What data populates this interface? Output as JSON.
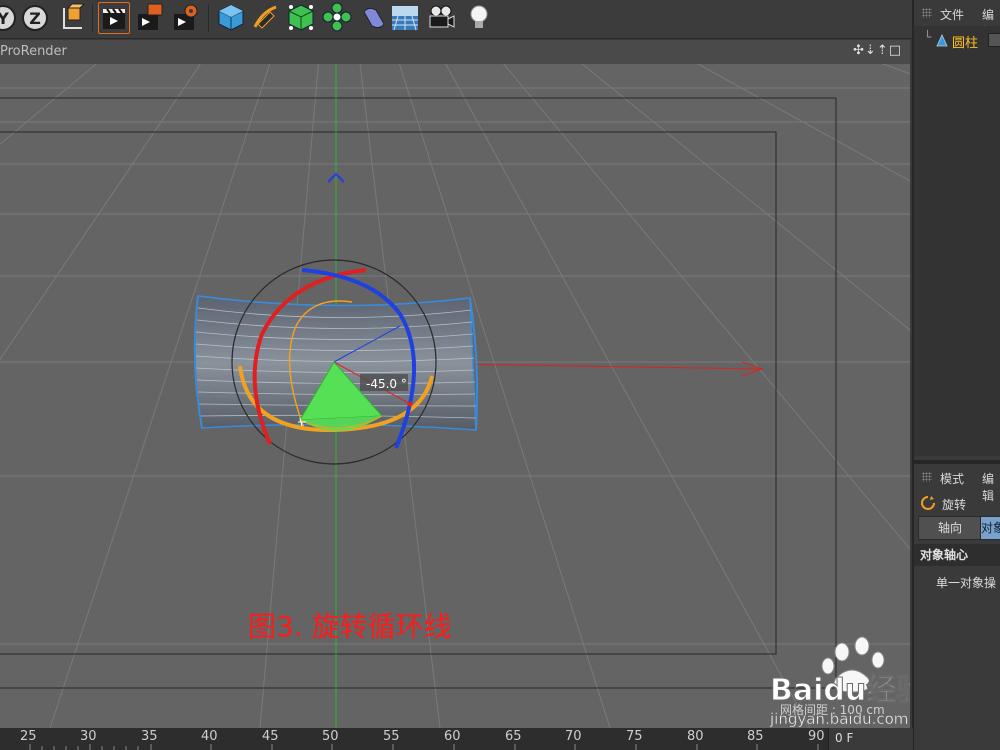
{
  "toolbar": {
    "buttons": [
      {
        "name": "axis-y-button",
        "glyph": "Y"
      },
      {
        "name": "axis-z-button",
        "glyph": "Z"
      },
      {
        "name": "coordinate-system-button",
        "glyph": ""
      },
      {
        "name": "render-view-button",
        "glyph": ""
      },
      {
        "name": "render-picture-viewer-button",
        "glyph": ""
      },
      {
        "name": "render-settings-button",
        "glyph": ""
      },
      {
        "name": "cube-object-button",
        "glyph": ""
      },
      {
        "name": "pen-spline-button",
        "glyph": ""
      },
      {
        "name": "subdivision-generator-button",
        "glyph": ""
      },
      {
        "name": "cloner-array-button",
        "glyph": ""
      },
      {
        "name": "deformer-button",
        "glyph": ""
      },
      {
        "name": "floor-environment-button",
        "glyph": ""
      },
      {
        "name": "camera-button",
        "glyph": ""
      },
      {
        "name": "light-button",
        "glyph": ""
      }
    ]
  },
  "viewport": {
    "title": "ProRender",
    "controls": "✣⇣⇡□",
    "hud_angle": "-45.0 °",
    "caption": "图3. 旋转循环线",
    "grid_spacing": "网格间距 : 100 cm"
  },
  "object_manager": {
    "menu": [
      "文件",
      "编辑"
    ],
    "object_name": "圆柱"
  },
  "attribute_manager": {
    "menu": [
      "模式",
      "编辑"
    ],
    "tool_name": "旋转",
    "tabs": [
      "轴向",
      "对象"
    ],
    "section_title": "对象轴心",
    "option_label": "单一对象操"
  },
  "timeline": {
    "ticks": [
      "25",
      "30",
      "35",
      "40",
      "45",
      "50",
      "55",
      "60",
      "65",
      "70",
      "75",
      "80",
      "85",
      "90"
    ],
    "current_frame": "0 F"
  },
  "watermark": {
    "brand": "Baidu经验",
    "url": "jingyan.baidu.com"
  },
  "colors": {
    "x_axis": "#e02020",
    "y_axis": "#2fb52f",
    "z_axis": "#2040e0",
    "view_ring": "#f2a020",
    "rotation_wedge": "#55e055",
    "caption": "#ff1a1a",
    "selection": "#ffc020"
  }
}
